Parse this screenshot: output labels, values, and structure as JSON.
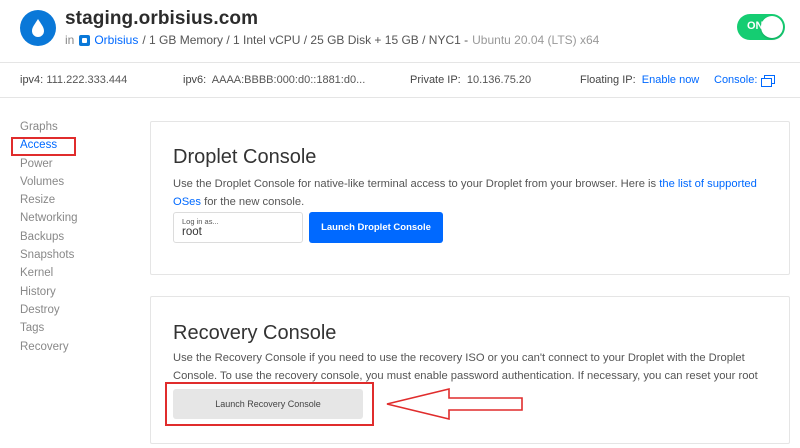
{
  "header": {
    "droplet_name": "staging.orbisius.com",
    "in_text": "in",
    "project_name": "Orbisius",
    "specs": "/ 1 GB Memory / 1 Intel vCPU / 25 GB Disk + 15 GB / NYC1 -",
    "os": "Ubuntu 20.04 (LTS) x64",
    "power_toggle_label": "ON"
  },
  "infobar": {
    "ipv4_label": "ipv4:",
    "ipv4_value": "111.222.333.444",
    "ipv6_label": "ipv6:",
    "ipv6_value": "AAAA:BBBB:000:d0::1881:d0...",
    "private_label": "Private IP:",
    "private_value": "10.136.75.20",
    "floating_label": "Floating IP:",
    "floating_link": "Enable now",
    "console_label": "Console:"
  },
  "sidebar": {
    "items": [
      {
        "label": "Graphs"
      },
      {
        "label": "Access"
      },
      {
        "label": "Power"
      },
      {
        "label": "Volumes"
      },
      {
        "label": "Resize"
      },
      {
        "label": "Networking"
      },
      {
        "label": "Backups"
      },
      {
        "label": "Snapshots"
      },
      {
        "label": "Kernel"
      },
      {
        "label": "History"
      },
      {
        "label": "Destroy"
      },
      {
        "label": "Tags"
      },
      {
        "label": "Recovery"
      }
    ],
    "active_index": 1
  },
  "droplet_console": {
    "title": "Droplet Console",
    "desc_prefix": "Use the Droplet Console for native-like terminal access to your Droplet from your browser. Here is",
    "desc_link": "the list of supported OSes",
    "desc_suffix": "for the new console.",
    "login_label": "Log in as...",
    "login_value": "root",
    "launch_label": "Launch Droplet Console"
  },
  "recovery_console": {
    "title": "Recovery Console",
    "desc": "Use the Recovery Console if you need to use the recovery ISO or you can't connect to your Droplet with the Droplet Console. To use the recovery console, you must enable password authentication. If necessary, you can reset your root password below.",
    "launch_label": "Launch Recovery Console"
  },
  "colors": {
    "accent": "#0069ff",
    "toggle_on": "#15cd72",
    "annotation": "#e02c2c"
  }
}
